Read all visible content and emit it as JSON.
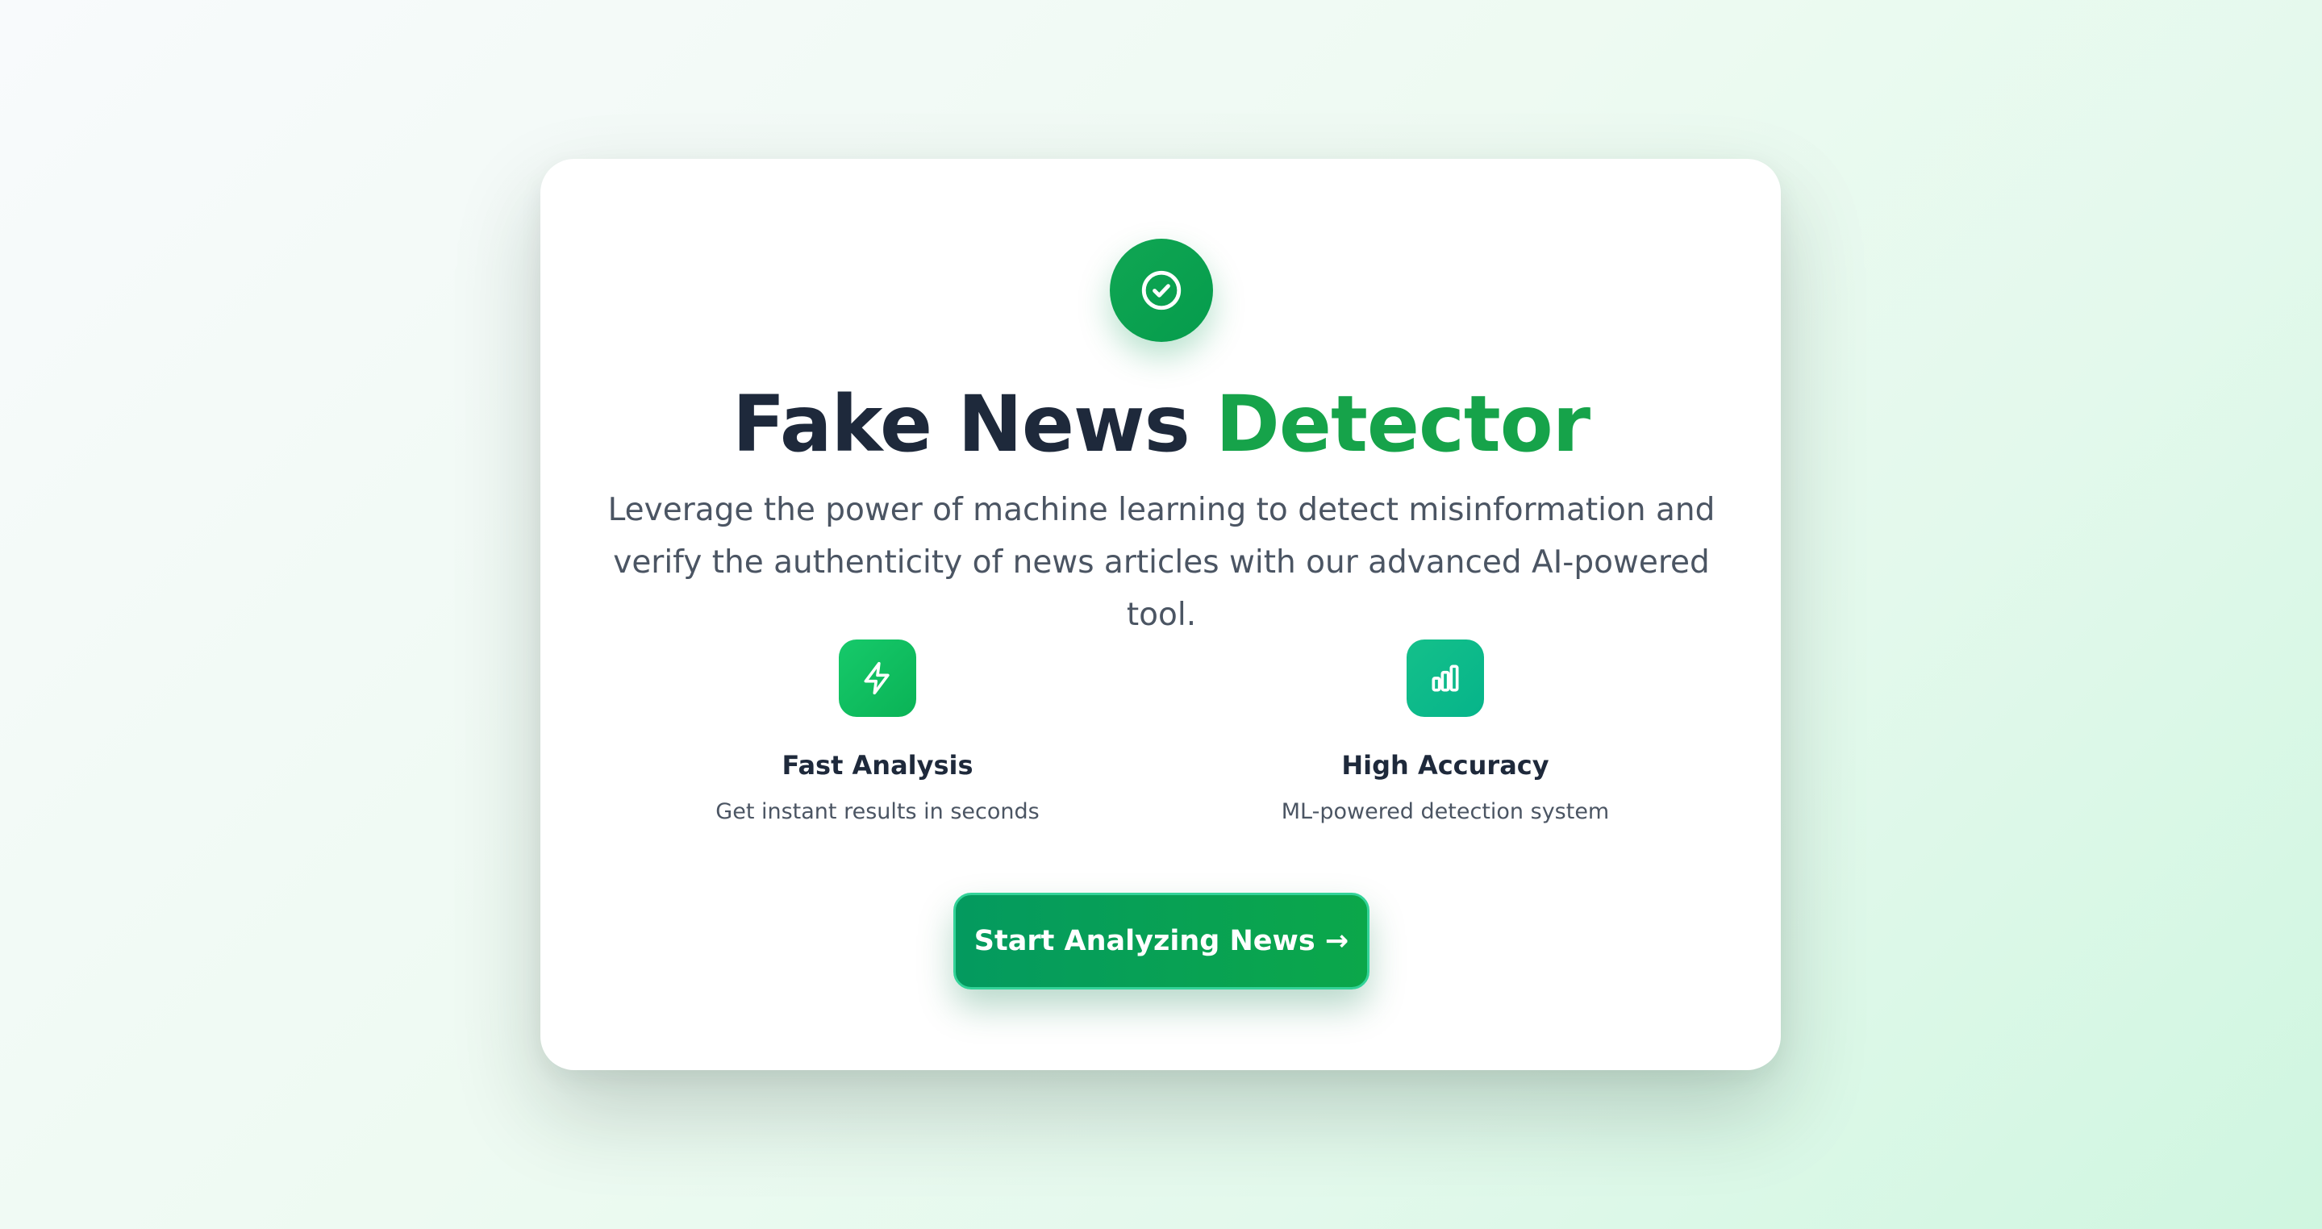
{
  "hero": {
    "icon": "check-circle-icon",
    "title_main": "Fake News ",
    "title_accent": "Detector",
    "subtitle": "Leverage the power of machine learning to detect misinformation and verify the authenticity of news articles with our advanced AI-powered tool."
  },
  "features": [
    {
      "icon": "lightning-bolt-icon",
      "title": "Fast Analysis",
      "description": "Get instant results in seconds"
    },
    {
      "icon": "bar-chart-icon",
      "title": "High Accuracy",
      "description": "ML-powered detection system"
    }
  ],
  "cta": {
    "label": "Start Analyzing News →"
  },
  "colors": {
    "accent": "#16a34a",
    "heading": "#1e293b",
    "body_text": "#4b5563",
    "card_background": "#ffffff"
  }
}
